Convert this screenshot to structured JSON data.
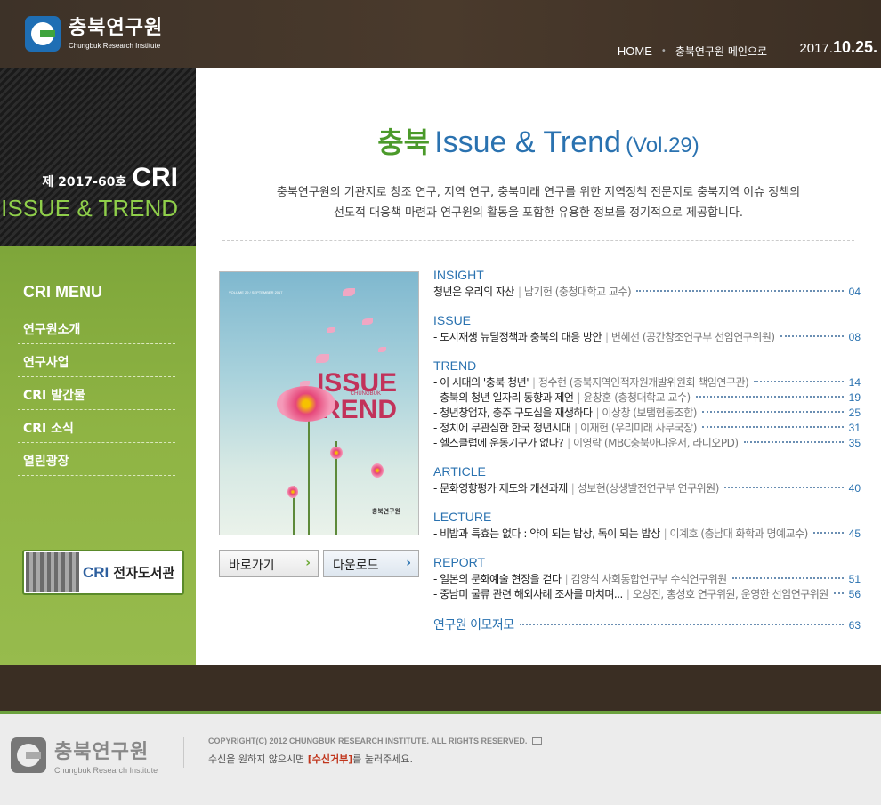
{
  "header": {
    "logo_ko": "충북연구원",
    "logo_en": "Chungbuk Research Institute",
    "nav_home": "HOME",
    "nav_main": "충북연구원 메인으로",
    "date_prefix": "2017.",
    "date_md": "10.25."
  },
  "banner": {
    "issue_no": "제 2017-60호",
    "cri": "CRI",
    "subtitle": "ISSUE & TREND"
  },
  "sidebar": {
    "menu_title": "CRI MENU",
    "items": [
      {
        "label": "연구원소개"
      },
      {
        "label": "연구사업"
      },
      {
        "label": "CRI 발간물"
      },
      {
        "label": "CRI 소식"
      },
      {
        "label": "열린광장"
      }
    ],
    "elib_cri": "CRI",
    "elib_label": "전자도서관"
  },
  "main": {
    "title_ko": "충북",
    "title_en": "Issue & Trend",
    "title_vol": "(Vol.29)",
    "intro_line1": "충북연구원의 기관지로 창조 연구, 지역 연구, 충북미래 연구를 위한 지역정책 전문지로 충북지역 이슈 정책의",
    "intro_line2": "선도적 대응책 마련과 연구원의 활동을 포함한 유용한 정보를 정기적으로 제공합니다.",
    "cover": {
      "vol_text": "VOLUME 29 / SEPTEMBER 2017",
      "issue": "ISSUE",
      "chungbuk": "CHUNGBUK",
      "trend": "&TREND",
      "logo": "충북연구원"
    },
    "btn_go": "바로가기",
    "btn_download": "다운로드"
  },
  "toc": {
    "insight": {
      "label": "INSIGHT",
      "rows": [
        {
          "title": "청년은 우리의 자산",
          "author": "남기헌 (충청대학교 교수)",
          "page": "04"
        }
      ]
    },
    "issue": {
      "label": "ISSUE",
      "rows": [
        {
          "title": "- 도시재생 뉴딜정책과 충북의 대응 방안",
          "author": "변혜선 (공간창조연구부 선임연구위원)",
          "page": "08"
        }
      ]
    },
    "trend": {
      "label": "TREND",
      "rows": [
        {
          "title": "- 이 시대의 '충북 청년'",
          "author": "정수현 (충북지역인적자원개발위원회 책임연구관)",
          "page": "14"
        },
        {
          "title": "- 충북의 청년 일자리 동향과 제언",
          "author": "윤창훈 (충청대학교 교수)",
          "page": "19"
        },
        {
          "title": "- 청년창업자, 충주 구도심을 재생하다",
          "author": "이상창 (보탬협동조합)",
          "page": "25"
        },
        {
          "title": "- 정치에 무관심한 한국 청년시대",
          "author": "이재헌 (우리미래 사무국장)",
          "page": "31"
        },
        {
          "title": "- 헬스클럽에 운동기구가 없다?",
          "author": "이영락 (MBC충북아나운서, 라디오PD)",
          "page": "35"
        }
      ]
    },
    "article": {
      "label": "ARTICLE",
      "rows": [
        {
          "title": "- 문화영향평가 제도와 개선과제",
          "author": "성보현(상생발전연구부 연구위원)",
          "page": "40"
        }
      ]
    },
    "lecture": {
      "label": "LECTURE",
      "rows": [
        {
          "title": "- 비밥과 특효는 없다 : 약이 되는 밥상, 독이 되는 밥상",
          "author": "이계호 (충남대 화학과 명예교수)",
          "page": "45"
        }
      ]
    },
    "report": {
      "label": "REPORT",
      "rows": [
        {
          "title": "- 일본의 문화예술 현장을 걷다",
          "author": "김양식 사회통합연구부 수석연구위원",
          "page": "51"
        },
        {
          "title": "- 중남미 물류 관련 해외사례 조사를 마치며...",
          "author": "오상진, 홍성호 연구위원, 운영한 선임연구위원",
          "page": "56"
        }
      ]
    },
    "staff": {
      "title": "연구원 이모저모",
      "page": "63"
    }
  },
  "footer": {
    "logo_ko": "충북연구원",
    "logo_en": "Chungbuk Research Institute",
    "copyright": "COPYRIGHT(C) 2012 CHUNGBUK RESEARCH INSTITUTE.  ALL RIGHTS RESERVED.",
    "notice_pre": "수신을 원하지 않으시면",
    "notice_link": "[수신거부]",
    "notice_post": "를 눌러주세요."
  }
}
